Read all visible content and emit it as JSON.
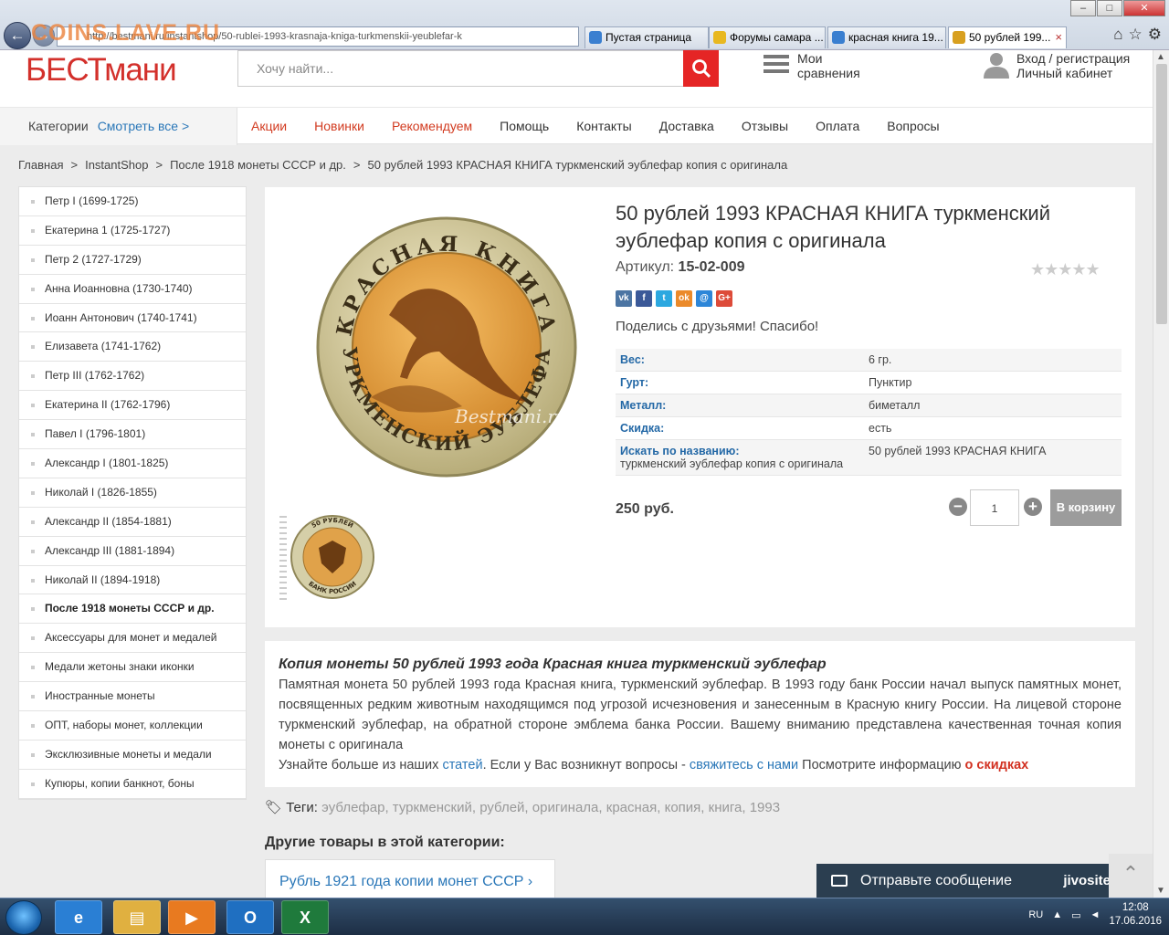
{
  "browser": {
    "watermark": "COINS.LAVE.RU",
    "address": "http://bestmani.ru/instantshop/50-rublei-1993-krasnaja-kniga-turkmenskii-yeublefar-k",
    "tabs": [
      {
        "label": "Пустая страница",
        "color": "#3a7fd0"
      },
      {
        "label": "Форумы самара ...",
        "color": "#e8b820"
      },
      {
        "label": "красная книга 19...",
        "color": "#3a7fd0"
      },
      {
        "label": "50 рублей 199...",
        "color": "#d8a020"
      }
    ],
    "tab_close": "×"
  },
  "header": {
    "logo": "БЕСТмани",
    "search_placeholder": "Хочу найти...",
    "compare_line1": "Мои",
    "compare_line2": "сравнения",
    "account_line1": "Вход / регистрация",
    "account_line2": "Личный кабинет"
  },
  "menu": {
    "categories": "Категории",
    "see_all": "Смотреть все >",
    "items": [
      {
        "label": "Акции",
        "red": true
      },
      {
        "label": "Новинки",
        "red": true
      },
      {
        "label": "Рекомендуем",
        "red": true
      },
      {
        "label": "Помощь",
        "red": false
      },
      {
        "label": "Контакты",
        "red": false
      },
      {
        "label": "Доставка",
        "red": false
      },
      {
        "label": "Отзывы",
        "red": false
      },
      {
        "label": "Оплата",
        "red": false
      },
      {
        "label": "Вопросы",
        "red": false
      }
    ]
  },
  "breadcrumbs": [
    "Главная",
    "InstantShop",
    "После 1918 монеты СССР и др.",
    "50 рублей 1993 КРАСНАЯ КНИГА туркменский эублефар копия с оригинала"
  ],
  "breadcrumb_sep": ">",
  "sidebar": [
    "Петр I (1699-1725)",
    "Екатерина 1 (1725-1727)",
    "Петр 2 (1727-1729)",
    "Анна Иоанновна (1730-1740)",
    "Иоанн Антонович (1740-1741)",
    "Елизавета (1741-1762)",
    "Петр III (1762-1762)",
    "Екатерина II (1762-1796)",
    "Павел I (1796-1801)",
    "Александр I (1801-1825)",
    "Николай I (1826-1855)",
    "Александр II (1854-1881)",
    "Александр III (1881-1894)",
    "Николай II (1894-1918)",
    "После 1918 монеты СССР и др.",
    "Аксессуары для монет и медалей",
    "Медали жетоны знаки иконки",
    "Иностранные монеты",
    "ОПТ, наборы монет, коллекции",
    "Эксклюзивные монеты и медали",
    "Купюры, копии банкнот, боны"
  ],
  "sidebar_active": 14,
  "product": {
    "title": "50 рублей 1993 КРАСНАЯ КНИГА туркменский эублефар копия с оригинала",
    "sku_label": "Артикул:",
    "sku": "15-02-009",
    "stars": "★★★★★",
    "coin_top": "КРАСНАЯ КНИГА",
    "coin_bottom": "ТУРКМЕНСКИЙ ЭУБЛЕФАР",
    "coin_watermark": "Bestmani.ru",
    "thumb_top": "50 РУБЛЕЙ",
    "thumb_bottom": "БАНК РОССИИ",
    "share_thanks": "Поделись с друзьями! Спасибо!",
    "shares": [
      {
        "icon": "vk-icon",
        "glyph": "vk",
        "color": "#4c75a3"
      },
      {
        "icon": "facebook-icon",
        "glyph": "f",
        "color": "#3b5998"
      },
      {
        "icon": "twitter-icon",
        "glyph": "t",
        "color": "#2ca8e0"
      },
      {
        "icon": "odnoklassniki-icon",
        "glyph": "ok",
        "color": "#eb8a2a"
      },
      {
        "icon": "mailru-icon",
        "glyph": "@",
        "color": "#2d86d8"
      },
      {
        "icon": "googleplus-icon",
        "glyph": "G+",
        "color": "#dd4b39"
      }
    ],
    "specs": [
      {
        "key": "Вес:",
        "value": "6 гр."
      },
      {
        "key": "Гурт:",
        "value": "Пунктир"
      },
      {
        "key": "Металл:",
        "value": "биметалл"
      },
      {
        "key": "Скидка:",
        "value": "есть"
      },
      {
        "key": "Искать по названию:",
        "key_sub": "туркменский эублефар копия с оригинала",
        "value": "50 рублей 1993 КРАСНАЯ КНИГА"
      }
    ],
    "price": "250 руб.",
    "qty": "1",
    "minus": "−",
    "plus": "+",
    "cart": "В корзину"
  },
  "description": {
    "heading": "Копия монеты 50 рублей 1993 года Красная книга туркменский эублефар",
    "body": "Памятная монета 50 рублей 1993 года Красная книга, туркменский эублефар. В 1993 году банк России начал выпуск памятных монет, посвященных редким животным находящимся под угрозой исчезновения и занесенным в Красную книгу России. На лицевой стороне туркменский эублефар, на обратной стороне эмблема банка России. Вашему вниманию представлена качественная точная копия монеты с оригинала",
    "more_prefix": "Узнайте больше из наших",
    "more_link": "статей",
    "ask_prefix": ". Если у Вас возникнут вопросы -",
    "ask_link": "свяжитесь с нами",
    "info_prefix": "Посмотрите информацию",
    "info_link": "о скидках"
  },
  "tags": {
    "label": "Теги:",
    "items": [
      "эублефар",
      "туркменский",
      "рублей",
      "оригинала",
      "красная",
      "копия",
      "книга",
      "1993"
    ]
  },
  "other": {
    "heading": "Другие товары в этой категории:",
    "item": "Рубль 1921 года копии монет СССР"
  },
  "chat": {
    "label": "Отправьте сообщение",
    "brand": "jivosite"
  },
  "taskbar": {
    "lang": "RU",
    "time": "12:08",
    "date": "17.06.2016",
    "apps": [
      {
        "name": "taskbar-ie",
        "glyph": "e",
        "color": "#2a7fd4"
      },
      {
        "name": "taskbar-explorer",
        "glyph": "▤",
        "color": "#e0b040"
      },
      {
        "name": "taskbar-media-player",
        "glyph": "▶",
        "color": "#e87a20"
      },
      {
        "name": "taskbar-outlook",
        "glyph": "O",
        "color": "#1f6fc1"
      },
      {
        "name": "taskbar-excel",
        "glyph": "X",
        "color": "#1f7a3c"
      }
    ]
  }
}
